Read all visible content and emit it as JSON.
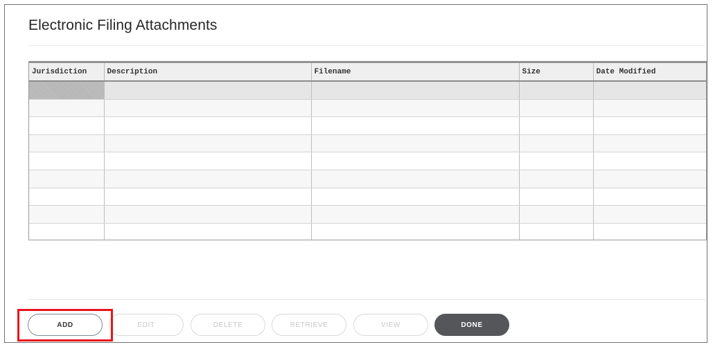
{
  "dialog": {
    "title": "Electronic Filing Attachments"
  },
  "table": {
    "columns": [
      "Jurisdiction",
      "Description",
      "Filename",
      "Size",
      "Date Modified"
    ],
    "rows": [
      [
        "",
        "",
        "",
        "",
        ""
      ],
      [
        "",
        "",
        "",
        "",
        ""
      ],
      [
        "",
        "",
        "",
        "",
        ""
      ],
      [
        "",
        "",
        "",
        "",
        ""
      ],
      [
        "",
        "",
        "",
        "",
        ""
      ],
      [
        "",
        "",
        "",
        "",
        ""
      ],
      [
        "",
        "",
        "",
        "",
        ""
      ],
      [
        "",
        "",
        "",
        "",
        ""
      ],
      [
        "",
        "",
        "",
        "",
        ""
      ]
    ],
    "selected_row": 0
  },
  "buttons": {
    "add": "ADD",
    "edit": "EDIT",
    "delete": "DELETE",
    "retrieve": "RETRIEVE",
    "view": "VIEW",
    "done": "DONE"
  },
  "colors": {
    "highlight": "#e8141b",
    "done_bg": "#55565a",
    "add_border": "#7d8a99"
  }
}
